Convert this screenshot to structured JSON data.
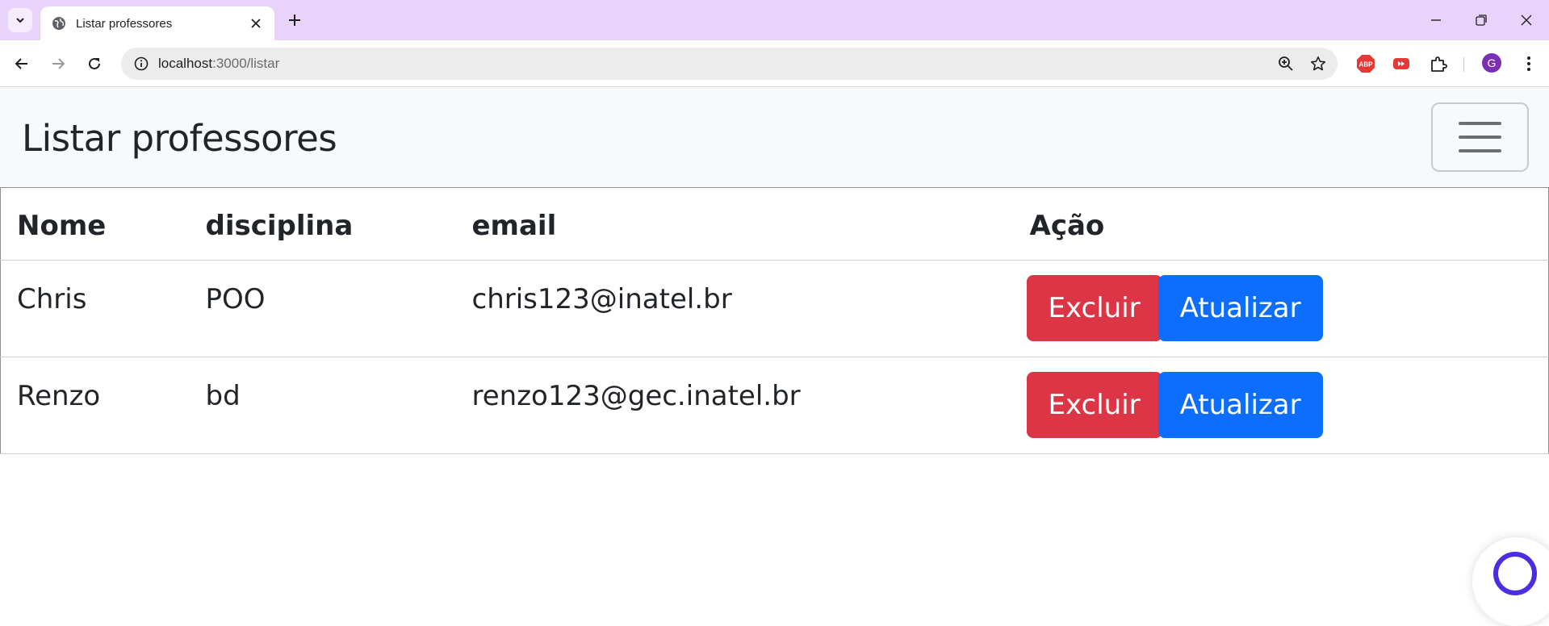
{
  "browser": {
    "tab_title": "Listar professores",
    "url_host": "localhost",
    "url_path": ":3000/listar",
    "avatar_letter": "G",
    "icons": [
      "tab-search-icon",
      "globe-icon",
      "close-icon",
      "plus-icon",
      "minimize-icon",
      "restore-icon",
      "back-icon",
      "forward-icon",
      "reload-icon",
      "site-info-icon",
      "zoom-icon",
      "star-icon",
      "adblock-icon",
      "youtube-ext-icon",
      "puzzle-icon",
      "kebab-menu-icon"
    ]
  },
  "page": {
    "brand": "Listar professores",
    "table": {
      "headers": [
        "Nome",
        "disciplina",
        "email",
        "Ação"
      ],
      "rows": [
        {
          "nome": "Chris",
          "disciplina": "POO",
          "email": "chris123@inatel.br"
        },
        {
          "nome": "Renzo",
          "disciplina": "bd",
          "email": "renzo123@gec.inatel.br"
        }
      ],
      "delete_label": "Excluir",
      "update_label": "Atualizar"
    }
  },
  "colors": {
    "tabstrip": "#e9d3fb",
    "danger": "#dc3545",
    "primary": "#0d6efd",
    "navbar": "#f8f9fa"
  }
}
